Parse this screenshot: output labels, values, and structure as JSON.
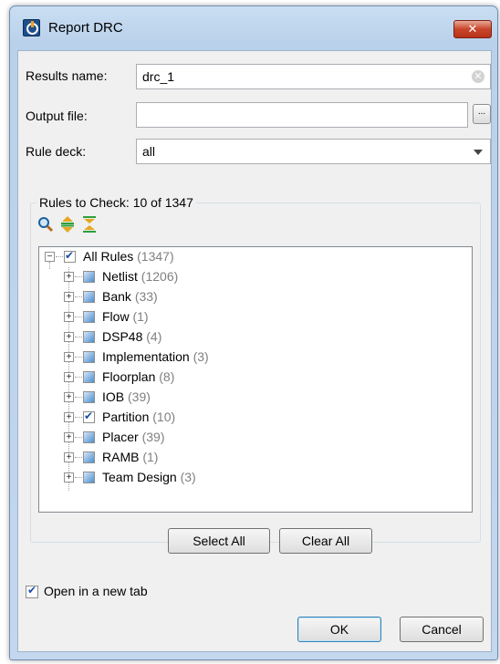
{
  "window": {
    "title": "Report DRC",
    "close_glyph": "✕"
  },
  "form": {
    "results_name_label": "Results name:",
    "results_name_value": "drc_1",
    "output_file_label": "Output file:",
    "output_file_value": "",
    "browse_label": "...",
    "rule_deck_label": "Rule deck:",
    "rule_deck_value": "all"
  },
  "rules_group": {
    "title": "Rules to Check: 10 of 1347"
  },
  "tree": {
    "root": {
      "label": "All Rules",
      "count": "(1347)",
      "checked": true
    },
    "items": [
      {
        "label": "Netlist",
        "count": "(1206)",
        "checked": false
      },
      {
        "label": "Bank",
        "count": "(33)",
        "checked": false
      },
      {
        "label": "Flow",
        "count": "(1)",
        "checked": false
      },
      {
        "label": "DSP48",
        "count": "(4)",
        "checked": false
      },
      {
        "label": "Implementation",
        "count": "(3)",
        "checked": false
      },
      {
        "label": "Floorplan",
        "count": "(8)",
        "checked": false
      },
      {
        "label": "IOB",
        "count": "(39)",
        "checked": false
      },
      {
        "label": "Partition",
        "count": "(10)",
        "checked": true
      },
      {
        "label": "Placer",
        "count": "(39)",
        "checked": false
      },
      {
        "label": "RAMB",
        "count": "(1)",
        "checked": false
      },
      {
        "label": "Team Design",
        "count": "(3)",
        "checked": false
      }
    ]
  },
  "buttons": {
    "select_all": "Select All",
    "clear_all": "Clear All",
    "ok": "OK",
    "cancel": "Cancel"
  },
  "options": {
    "open_new_tab_label": "Open in a new tab",
    "open_new_tab_checked": true
  },
  "icons": {
    "app": "report-drc-icon",
    "search": "search-icon",
    "expand_all": "expand-all-icon",
    "collapse_all": "collapse-all-icon"
  }
}
